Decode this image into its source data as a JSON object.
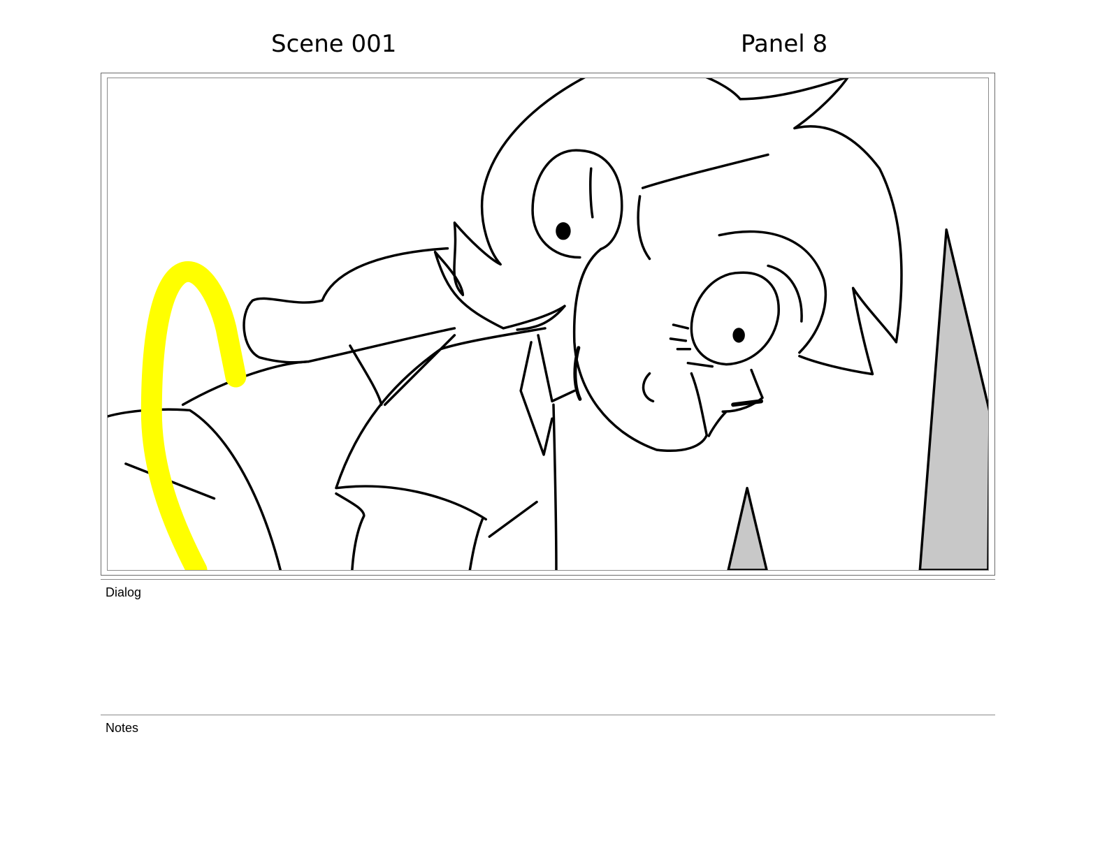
{
  "header": {
    "scene": "Scene 001",
    "panel": "Panel 8"
  },
  "sections": {
    "dialog_label": "Dialog",
    "dialog_text": "",
    "notes_label": "Notes",
    "notes_text": ""
  },
  "colors": {
    "highlight": "#ffff00",
    "shadow_fill": "#c8c8c8",
    "ink": "#000000"
  }
}
